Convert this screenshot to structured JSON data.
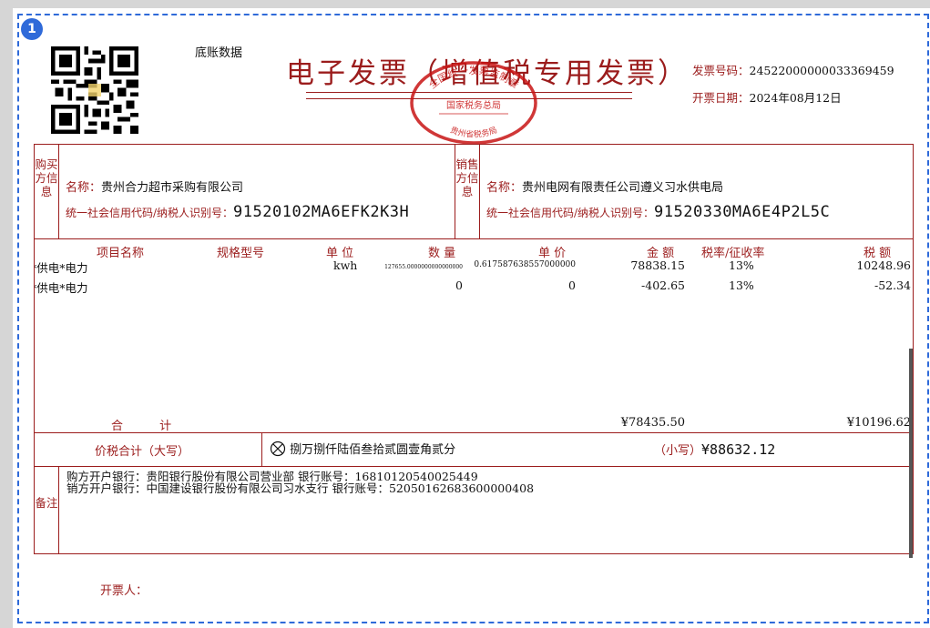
{
  "page_badge": "1",
  "ledger_label": "底账数据",
  "title": "电子发票（增值税专用发票）",
  "seal": {
    "outer_text": "全国统一发票监制章",
    "middle_text": "国家税务总局",
    "bottom_text": "贵州省税务局"
  },
  "invoice_number": {
    "label": "发票号码：",
    "value": "24522000000033369459"
  },
  "issue_date": {
    "label": "开票日期：",
    "value": "2024年08月12日"
  },
  "buyer": {
    "section_label": "购买方信息",
    "name_label": "名称：",
    "name": "贵州合力超市采购有限公司",
    "tax_label": "统一社会信用代码/纳税人识别号：",
    "tax_id": "91520102MA6EFK2K3H"
  },
  "seller": {
    "section_label": "销售方信息",
    "name_label": "名称：",
    "name": "贵州电网有限责任公司遵义习水供电局",
    "tax_label": "统一社会信用代码/纳税人识别号：",
    "tax_id": "91520330MA6E4P2L5C"
  },
  "columns": {
    "item": "项目名称",
    "spec": "规格型号",
    "unit": "单 位",
    "qty": "数 量",
    "price": "单 价",
    "amount": "金 额",
    "rate": "税率/征收率",
    "tax": "税 额"
  },
  "items": [
    {
      "name": "*供电*电力",
      "spec": "",
      "unit": "kwh",
      "qty": "127655.0000000000000000",
      "price": "0.617587638557000000",
      "amount": "78838.15",
      "rate": "13%",
      "tax": "10248.96"
    },
    {
      "name": "*供电*电力",
      "spec": "",
      "unit": "",
      "qty": "0",
      "price": "0",
      "amount": "-402.65",
      "rate": "13%",
      "tax": "-52.34"
    }
  ],
  "totals": {
    "label": "合 计",
    "amount": "¥78435.50",
    "tax": "¥10196.62"
  },
  "total_in_words": {
    "label": "价税合计（大写）",
    "words": "捌万捌仟陆佰叁拾贰圆壹角贰分",
    "small_label": "（小写）",
    "small_value": "¥88632.12"
  },
  "remarks": {
    "label": "备注",
    "lines": [
      "购方开户银行：贵阳银行股份有限公司营业部 银行账号：16810120540025449",
      "销方开户银行：中国建设银行股份有限公司习水支行 银行账号：52050162683600000408"
    ]
  },
  "issuer_label": "开票人：",
  "colors": {
    "accent": "#9b1c1c",
    "badge": "#2f6ad9"
  }
}
